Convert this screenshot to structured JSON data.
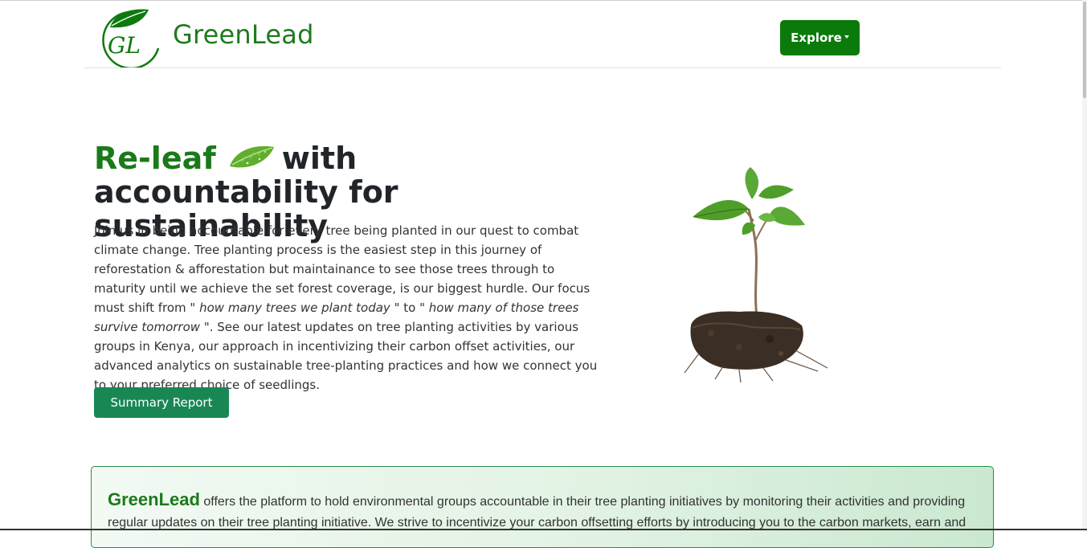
{
  "navbar": {
    "logo_text": "GL",
    "brand": "GreenLead",
    "explore_label": "Explore"
  },
  "hero": {
    "title_accent": "Re-leaf",
    "title_rest": "with accountability for sustainability",
    "text": {
      "part1": "Join us in being accountable for every tree being planted in our quest to combat climate change. Tree planting process is the easiest step in this journey of reforestation & afforestation but maintainance to see those trees through to maturity until we achieve the set forest coverage, is our biggest hurdle. Our focus must shift from \"",
      "em1": " how many trees we plant today ",
      "part2": "\" to \"",
      "em2": " how many of those trees survive tomorrow ",
      "part3": "\". See our latest updates on tree planting activities by various groups in Kenya, our approach in incentivizing their carbon offset activities, our advanced analytics on sustainable tree-planting practices and how we connect you to your preferred choice of seedlings."
    },
    "button_label": "Summary Report"
  },
  "info": {
    "brand": "GreenLead",
    "text": " offers the platform to hold environmental groups accountable in their tree planting initiatives by monitoring their activities and providing regular updates on their tree planting initiative. We strive to incentivize your carbon offsetting efforts by introducing you to the carbon markets, earn and"
  },
  "icons": {
    "logo": "greenlead-logo",
    "leaf": "leaf-icon",
    "plant": "seedling-image",
    "caret": "caret-down-icon"
  },
  "colors": {
    "brand_green": "#1a7a1a",
    "explore_button": "#0a7a0a",
    "summary_button": "#198754",
    "info_border": "#2d8a4e"
  }
}
